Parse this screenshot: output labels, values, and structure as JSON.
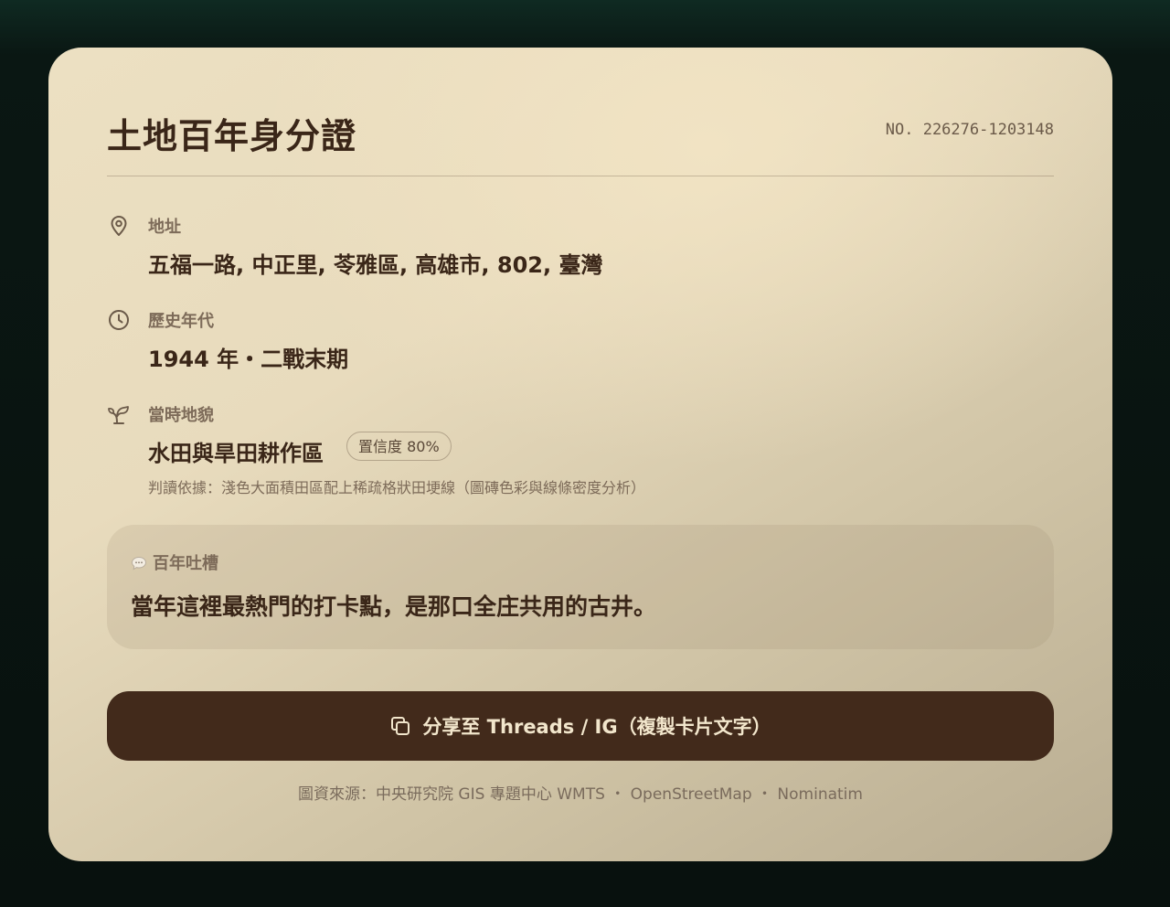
{
  "card": {
    "title": "土地百年身分證",
    "serial": "NO. 226276-1203148"
  },
  "address": {
    "icon": "location-pin-icon",
    "label": "地址",
    "value": "五福一路, 中正里, 苓雅區, 高雄市, 802, 臺灣"
  },
  "era": {
    "icon": "clock-icon",
    "label": "歷史年代",
    "value": "1944 年・二戰末期"
  },
  "landscape": {
    "icon": "sprout-icon",
    "label": "當時地貌",
    "value": "水田與旱田耕作區",
    "confidence": "置信度 80%",
    "basis": "判讀依據：淺色大面積田區配上稀疏格狀田埂線（圖磚色彩與線條密度分析）"
  },
  "quote": {
    "icon": "speech-bubble-icon",
    "label": "百年吐槽",
    "text": "當年這裡最熱門的打卡點，是那口全庄共用的古井。"
  },
  "share_button": {
    "icon": "copy-icon",
    "label": "分享至 Threads / IG（複製卡片文字）"
  },
  "footer": {
    "text": "圖資來源：中央研究院 GIS 專題中心 WMTS ・ OpenStreetMap ・ Nominatim"
  },
  "colors": {
    "text_dark": "#3a2618",
    "text_muted": "#7d6b59",
    "button_bg": "#422a1b",
    "button_text": "#f2e6cc",
    "page_bg": "#08110e"
  }
}
